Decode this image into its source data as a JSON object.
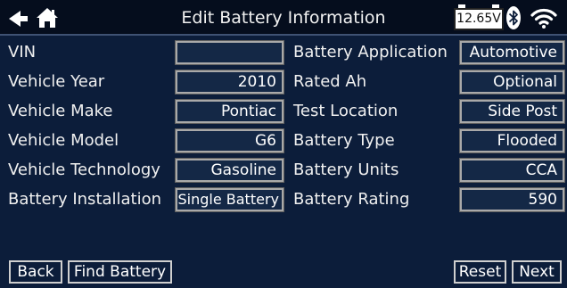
{
  "header": {
    "title": "Edit Battery Information",
    "battery_voltage": "12.65V"
  },
  "left_rows": [
    {
      "label": "VIN",
      "value": ""
    },
    {
      "label": "Vehicle Year",
      "value": "2010"
    },
    {
      "label": "Vehicle Make",
      "value": "Pontiac"
    },
    {
      "label": "Vehicle Model",
      "value": "G6"
    },
    {
      "label": "Vehicle Technology",
      "value": "Gasoline"
    },
    {
      "label": "Battery Installation",
      "value": "Single Battery"
    }
  ],
  "right_rows": [
    {
      "label": "Battery Application",
      "value": "Automotive"
    },
    {
      "label": "Rated Ah",
      "value": "Optional"
    },
    {
      "label": "Test Location",
      "value": "Side Post"
    },
    {
      "label": "Battery Type",
      "value": "Flooded"
    },
    {
      "label": "Battery Units",
      "value": "CCA"
    },
    {
      "label": "Battery Rating",
      "value": "590"
    }
  ],
  "footer": {
    "back_label": "Back",
    "find_battery_label": "Find Battery",
    "reset_label": "Reset",
    "next_label": "Next"
  },
  "icons": {
    "back": "back-arrow-icon",
    "home": "home-icon",
    "battery": "battery-icon",
    "bluetooth": "bluetooth-icon",
    "wifi": "wifi-icon"
  },
  "colors": {
    "background": "#0c1d3a",
    "header_background": "#050d1d",
    "field_border": "#a9a9a9",
    "text": "#ffffff",
    "bluetooth_badge": "#ffffff"
  }
}
